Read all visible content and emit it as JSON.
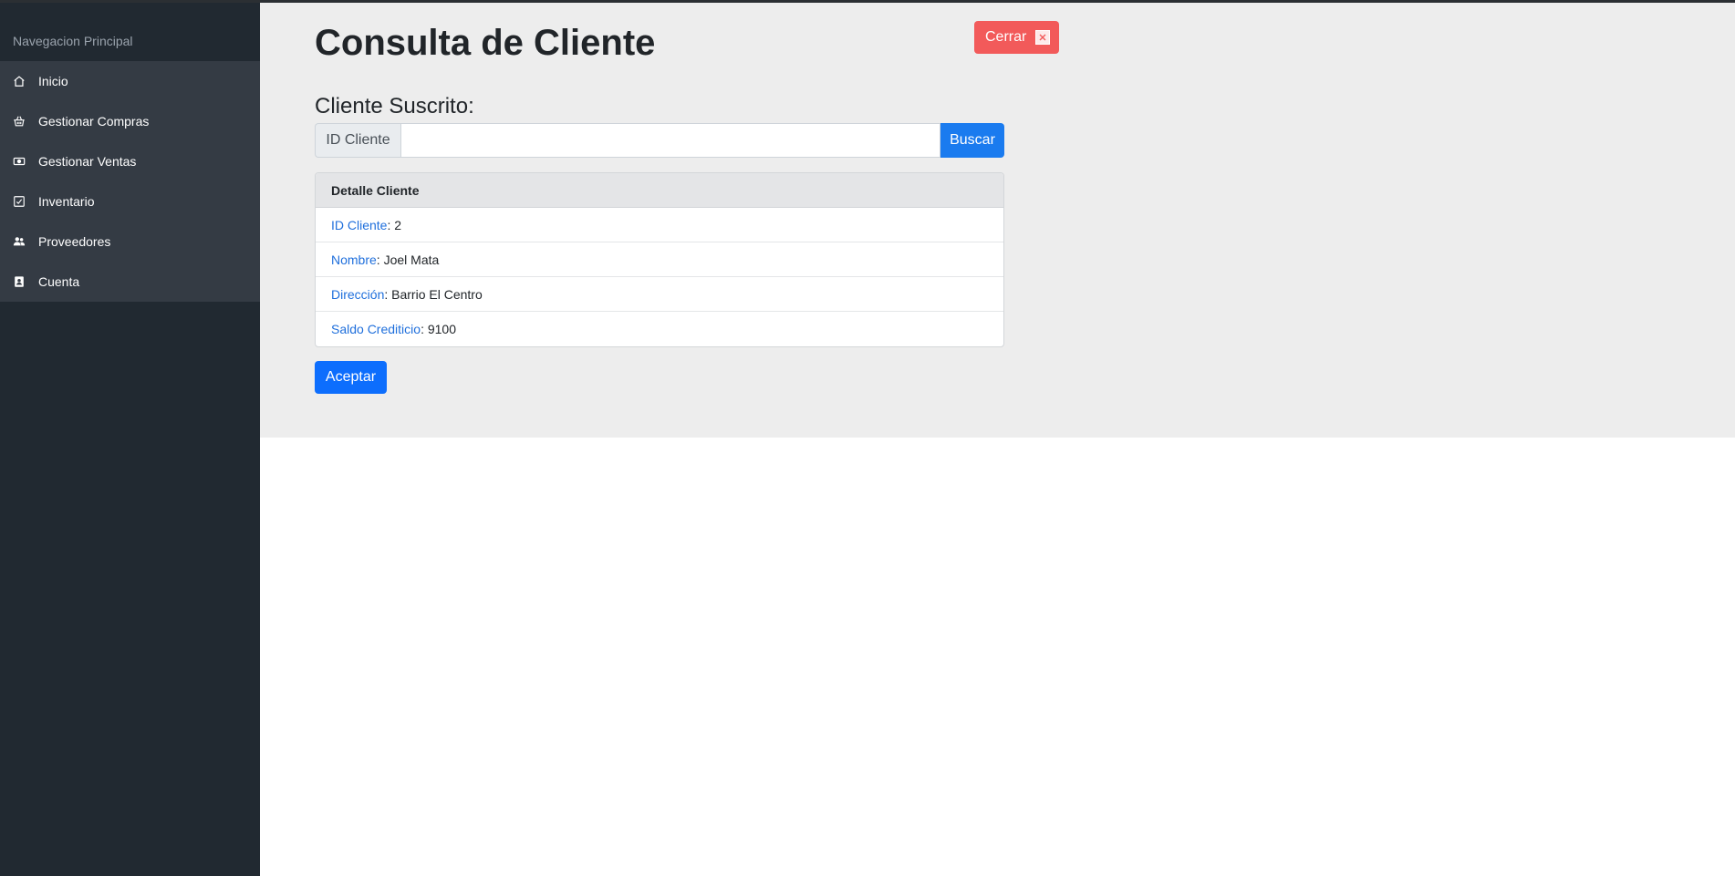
{
  "sidebar": {
    "heading": "Navegacion Principal",
    "items": [
      {
        "label": "Inicio",
        "icon": "home-icon"
      },
      {
        "label": "Gestionar Compras",
        "icon": "basket-icon"
      },
      {
        "label": "Gestionar Ventas",
        "icon": "cash-icon"
      },
      {
        "label": "Inventario",
        "icon": "checklist-icon"
      },
      {
        "label": "Proveedores",
        "icon": "people-icon"
      },
      {
        "label": "Cuenta",
        "icon": "contact-card-icon"
      }
    ]
  },
  "header": {
    "title": "Consulta de Cliente",
    "close_label": "Cerrar"
  },
  "search": {
    "section_title": "Cliente Suscrito:",
    "prefix": "ID Cliente",
    "value": "",
    "placeholder": "",
    "button_label": "Buscar"
  },
  "detail": {
    "header": "Detalle Cliente",
    "rows": [
      {
        "label": "ID Cliente",
        "value": "2"
      },
      {
        "label": "Nombre",
        "value": "Joel Mata"
      },
      {
        "label": "Dirección",
        "value": "Barrio El Centro"
      },
      {
        "label": "Saldo Crediticio",
        "value": "9100"
      }
    ]
  },
  "actions": {
    "accept_label": "Aceptar"
  },
  "colors": {
    "sidebar_bg": "#212931",
    "sidebar_menu_bg": "#343b44",
    "panel_bg": "#ededed",
    "primary": "#0d6efd",
    "danger": "#f25a5a",
    "link": "#1f6fdc"
  }
}
